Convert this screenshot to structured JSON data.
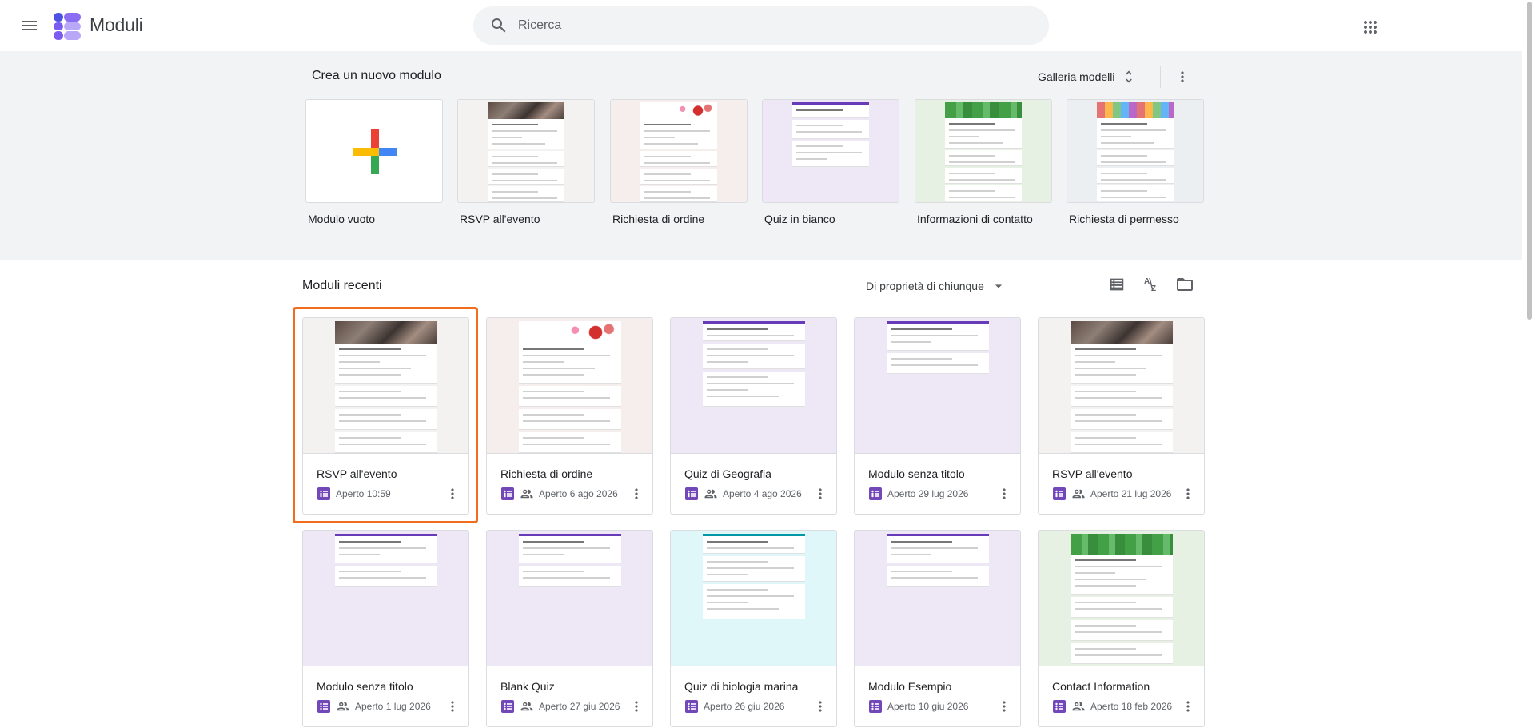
{
  "app": {
    "title": "Moduli"
  },
  "search": {
    "placeholder": "Ricerca"
  },
  "gallery": {
    "title": "Crea un nuovo modulo",
    "gallery_button": "Galleria modelli",
    "templates": [
      {
        "label": "Modulo vuoto",
        "kind": "blank"
      },
      {
        "label": "RSVP all'evento",
        "kind": "photo"
      },
      {
        "label": "Richiesta di ordine",
        "kind": "flowers"
      },
      {
        "label": "Quiz in bianco",
        "kind": "quiz"
      },
      {
        "label": "Informazioni di contatto",
        "kind": "green"
      },
      {
        "label": "Richiesta di permesso",
        "kind": "mosaic"
      }
    ]
  },
  "recent": {
    "title": "Moduli recenti",
    "owner_filter": "Di proprietà di chiunque",
    "forms": [
      {
        "title": "RSVP all'evento",
        "opened": "Aperto 10:59",
        "shared": false,
        "kind": "photo",
        "selected": true
      },
      {
        "title": "Richiesta di ordine",
        "opened": "Aperto 6 ago 2026",
        "shared": true,
        "kind": "flowers"
      },
      {
        "title": "Quiz di Geografia",
        "opened": "Aperto 4 ago 2026",
        "shared": true,
        "kind": "quiz"
      },
      {
        "title": "Modulo senza titolo",
        "opened": "Aperto 29 lug 2026",
        "shared": false,
        "kind": "plain"
      },
      {
        "title": "RSVP all'evento",
        "opened": "Aperto 21 lug 2026",
        "shared": true,
        "kind": "photo"
      },
      {
        "title": "Modulo senza titolo",
        "opened": "Aperto 1 lug 2026",
        "shared": true,
        "kind": "plain"
      },
      {
        "title": "Blank Quiz",
        "opened": "Aperto 27 giu 2026",
        "shared": true,
        "kind": "plain"
      },
      {
        "title": "Quiz di biologia marina",
        "opened": "Aperto 26 giu 2026",
        "shared": false,
        "kind": "teal"
      },
      {
        "title": "Modulo Esempio",
        "opened": "Aperto 10 giu 2026",
        "shared": false,
        "kind": "plain"
      },
      {
        "title": "Contact Information",
        "opened": "Aperto 18 feb 2026",
        "shared": true,
        "kind": "green"
      }
    ]
  },
  "colors": {
    "forms_purple": "#673ab7",
    "selection": "#f26c1d",
    "lavender": "#ede7f6",
    "teal_bg": "#e0f7fa",
    "green_bg": "#e6f1e3"
  },
  "icons": [
    "menu-icon",
    "forms-logo-icon",
    "search-icon",
    "apps-grid-icon",
    "unfold-icon",
    "more-vert-icon",
    "list-view-icon",
    "sort-az-icon",
    "folder-icon",
    "forms-file-icon",
    "people-icon",
    "dropdown-arrow-icon"
  ]
}
